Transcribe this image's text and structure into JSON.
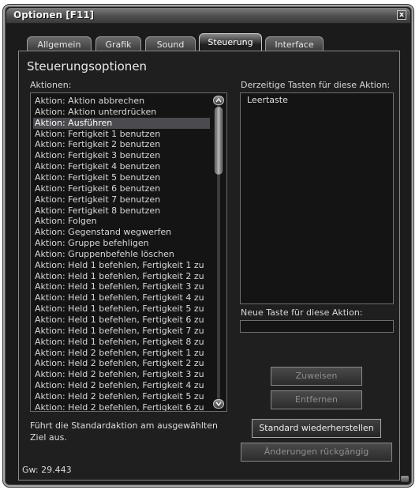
{
  "window": {
    "title": "Optionen [F11]",
    "close_label": "x"
  },
  "tabs": [
    {
      "label": "Allgemein",
      "active": false
    },
    {
      "label": "Grafik",
      "active": false
    },
    {
      "label": "Sound",
      "active": false
    },
    {
      "label": "Steuerung",
      "active": true
    },
    {
      "label": "Interface",
      "active": false
    }
  ],
  "heading": "Steuerungsoptionen",
  "actions_label": "Aktionen:",
  "actions": [
    "Aktion: Aktion abbrechen",
    "Aktion: Aktion unterdrücken",
    "Aktion: Ausführen",
    "Aktion: Fertigkeit 1 benutzen",
    "Aktion: Fertigkeit 2 benutzen",
    "Aktion: Fertigkeit 3 benutzen",
    "Aktion: Fertigkeit 4 benutzen",
    "Aktion: Fertigkeit 5 benutzen",
    "Aktion: Fertigkeit 6 benutzen",
    "Aktion: Fertigkeit 7 benutzen",
    "Aktion: Fertigkeit 8 benutzen",
    "Aktion: Folgen",
    "Aktion: Gegenstand wegwerfen",
    "Aktion: Gruppe befehligen",
    "Aktion: Gruppenbefehle löschen",
    "Aktion: Held 1 befehlen, Fertigkeit 1 zu",
    "Aktion: Held 1 befehlen, Fertigkeit 2 zu",
    "Aktion: Held 1 befehlen, Fertigkeit 3 zu",
    "Aktion: Held 1 befehlen, Fertigkeit 4 zu",
    "Aktion: Held 1 befehlen, Fertigkeit 5 zu",
    "Aktion: Held 1 befehlen, Fertigkeit 6 zu",
    "Aktion: Held 1 befehlen, Fertigkeit 7 zu",
    "Aktion: Held 1 befehlen, Fertigkeit 8 zu",
    "Aktion: Held 2 befehlen, Fertigkeit 1 zu",
    "Aktion: Held 2 befehlen, Fertigkeit 2 zu",
    "Aktion: Held 2 befehlen, Fertigkeit 3 zu",
    "Aktion: Held 2 befehlen, Fertigkeit 4 zu",
    "Aktion: Held 2 befehlen, Fertigkeit 5 zu",
    "Aktion: Held 2 befehlen, Fertigkeit 6 zu"
  ],
  "selected_index": 2,
  "current_keys_label": "Derzeitige Tasten für diese Aktion:",
  "current_keys": [
    "Leertaste"
  ],
  "new_key_label": "Neue Taste für diese Aktion:",
  "new_key_value": "",
  "buttons": {
    "assign": "Zuweisen",
    "remove": "Entfernen",
    "restore_defaults": "Standard wiederherstellen",
    "undo_changes": "Änderungen rückgängig"
  },
  "description": "Führt die Standardaktion am ausgewählten Ziel aus.",
  "status": "Gw: 29.443",
  "colors": {
    "background": "#1b1b1c",
    "selection": "#4a4a4f",
    "text": "#d8d8d8"
  }
}
